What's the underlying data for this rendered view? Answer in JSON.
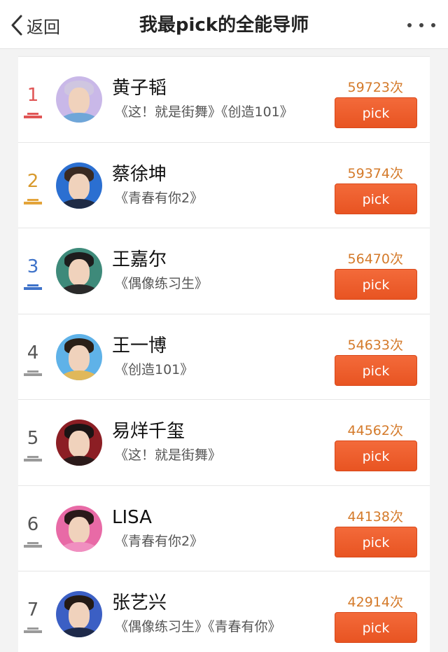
{
  "header": {
    "back_label": "返回",
    "title": "我最pick的全能导师"
  },
  "rows": [
    {
      "rank": "1",
      "name": "黄子韬",
      "shows": "《这！就是街舞》《创造101》",
      "count": "59723次",
      "button": "pick",
      "rank_color": "#e05555",
      "avatar_bg": "#c9b8e8",
      "hair": "#cfc6e0",
      "shoulders": "#6fa6d8"
    },
    {
      "rank": "2",
      "name": "蔡徐坤",
      "shows": "《青春有你2》",
      "count": "59374次",
      "button": "pick",
      "rank_color": "#d89a2e",
      "avatar_bg": "#2b6fd1",
      "hair": "#3a2a22",
      "shoulders": "#1f2b45"
    },
    {
      "rank": "3",
      "name": "王嘉尔",
      "shows": "《偶像练习生》",
      "count": "56470次",
      "button": "pick",
      "rank_color": "#3f73c9",
      "avatar_bg": "#3e8a7a",
      "hair": "#1d1d1d",
      "shoulders": "#2a2a2a"
    },
    {
      "rank": "4",
      "name": "王一博",
      "shows": "《创造101》",
      "count": "54633次",
      "button": "pick",
      "rank_color": "#555555",
      "avatar_bg": "#5fb2e8",
      "hair": "#2a2018",
      "shoulders": "#e0b85a"
    },
    {
      "rank": "5",
      "name": "易烊千玺",
      "shows": "《这！就是街舞》",
      "count": "44562次",
      "button": "pick",
      "rank_color": "#555555",
      "avatar_bg": "#8c1e24",
      "hair": "#1b1414",
      "shoulders": "#2b1a1a"
    },
    {
      "rank": "6",
      "name": "LISA",
      "shows": "《青春有你2》",
      "count": "44138次",
      "button": "pick",
      "rank_color": "#555555",
      "avatar_bg": "#e86aa6",
      "hair": "#2a1a1a",
      "shoulders": "#f08fc0"
    },
    {
      "rank": "7",
      "name": "张艺兴",
      "shows": "《偶像练习生》《青春有你》",
      "count": "42914次",
      "button": "pick",
      "rank_color": "#555555",
      "avatar_bg": "#3b5fc4",
      "hair": "#241a14",
      "shoulders": "#1e2a4a"
    }
  ]
}
